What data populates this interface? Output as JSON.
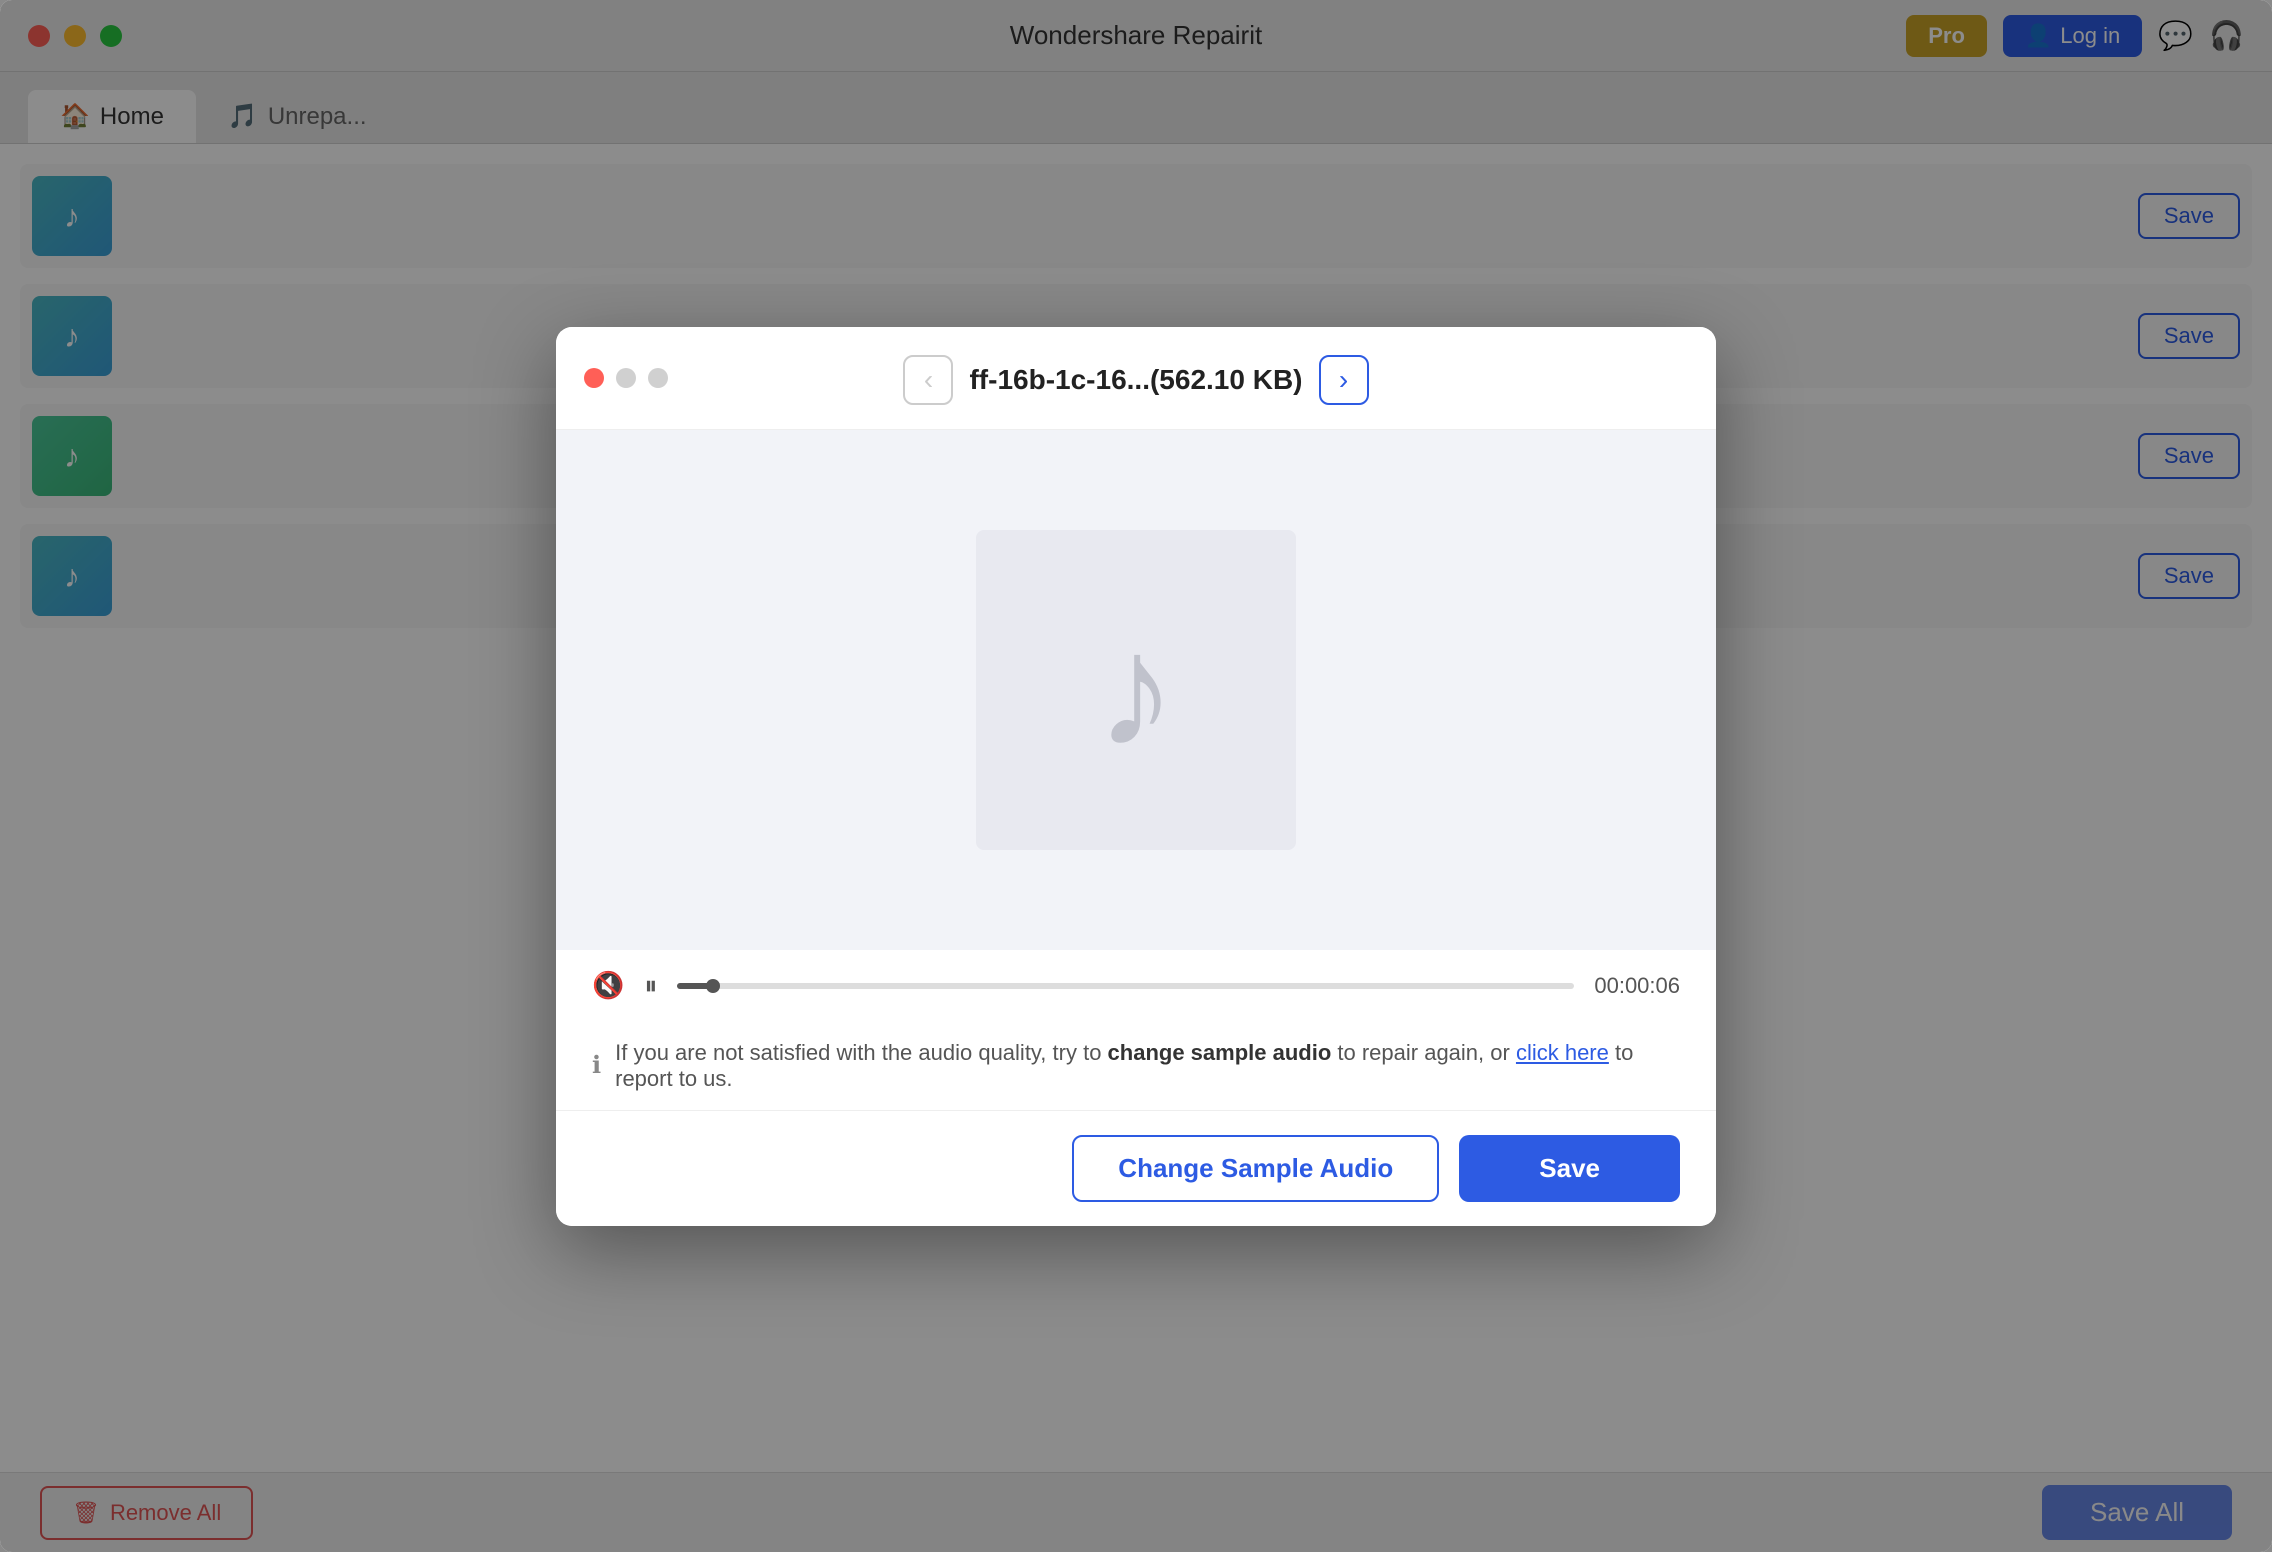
{
  "app": {
    "title": "Wondershare Repairit"
  },
  "title_bar": {
    "pro_label": "Pro",
    "login_label": "Log in"
  },
  "tabs": [
    {
      "label": "Home",
      "active": true
    },
    {
      "label": "Unrepa...",
      "active": false
    }
  ],
  "file_list": {
    "items": [
      {
        "thumb_type": "blue",
        "save_label": "Save"
      },
      {
        "thumb_type": "blue",
        "save_label": "Save"
      },
      {
        "thumb_type": "green",
        "save_label": "Save"
      },
      {
        "thumb_type": "blue",
        "save_label": "Save"
      }
    ]
  },
  "bottom_bar": {
    "remove_all_label": "Remove All",
    "save_all_label": "Save All"
  },
  "modal": {
    "filename": "ff-16b-1c-16...(562.10 KB)",
    "nav_prev_disabled": true,
    "nav_next_disabled": false,
    "audio_icon": "♪",
    "playback": {
      "time": "00:00:06",
      "progress_percent": 4
    },
    "info_text_before": "If you are not satisfied with the audio quality, try to ",
    "info_bold": "change sample audio",
    "info_text_middle": " to repair again, or ",
    "info_link": "click here",
    "info_text_after": " to report to us.",
    "change_sample_label": "Change Sample Audio",
    "save_label": "Save"
  },
  "colors": {
    "accent_blue": "#2d5be3",
    "accent_gold": "#c9a227",
    "danger_red": "#e05555"
  }
}
